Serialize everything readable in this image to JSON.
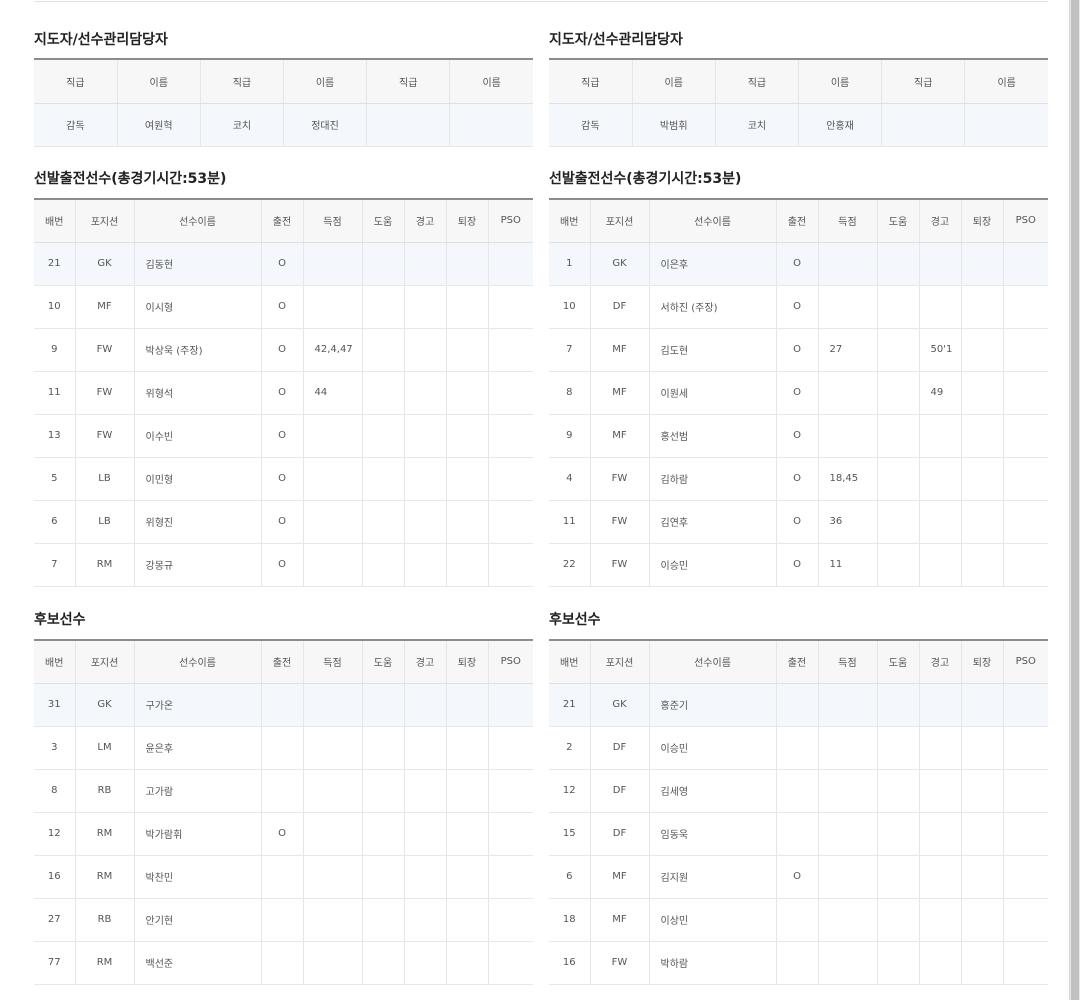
{
  "headers": {
    "staff": [
      "직급",
      "이름",
      "직급",
      "이름",
      "직급",
      "이름"
    ],
    "players": [
      "배번",
      "포지션",
      "선수이름",
      "출전",
      "득점",
      "도움",
      "경고",
      "퇴장",
      "PSO"
    ]
  },
  "home": {
    "staff_title": "지도자/선수관리담당자",
    "staff": [
      "감독",
      "여원혁",
      "코치",
      "정대진",
      "",
      ""
    ],
    "starters_title": "선발출전선수(총경기시간:53분)",
    "starters": [
      [
        "21",
        "GK",
        "김동현",
        "O",
        "",
        "",
        "",
        "",
        ""
      ],
      [
        "10",
        "MF",
        "이시형",
        "O",
        "",
        "",
        "",
        "",
        ""
      ],
      [
        "9",
        "FW",
        "박상욱 (주장)",
        "O",
        "42,4,47",
        "",
        "",
        "",
        ""
      ],
      [
        "11",
        "FW",
        "위형석",
        "O",
        "44",
        "",
        "",
        "",
        ""
      ],
      [
        "13",
        "FW",
        "이수빈",
        "O",
        "",
        "",
        "",
        "",
        ""
      ],
      [
        "5",
        "LB",
        "이민형",
        "O",
        "",
        "",
        "",
        "",
        ""
      ],
      [
        "6",
        "LB",
        "위형진",
        "O",
        "",
        "",
        "",
        "",
        ""
      ],
      [
        "7",
        "RM",
        "강몽규",
        "O",
        "",
        "",
        "",
        "",
        ""
      ]
    ],
    "subs_title": "후보선수",
    "subs": [
      [
        "31",
        "GK",
        "구가온",
        "",
        "",
        "",
        "",
        "",
        ""
      ],
      [
        "3",
        "LM",
        "윤은후",
        "",
        "",
        "",
        "",
        "",
        ""
      ],
      [
        "8",
        "RB",
        "고가람",
        "",
        "",
        "",
        "",
        "",
        ""
      ],
      [
        "12",
        "RM",
        "박가람휘",
        "O",
        "",
        "",
        "",
        "",
        ""
      ],
      [
        "16",
        "RM",
        "박찬민",
        "",
        "",
        "",
        "",
        "",
        ""
      ],
      [
        "27",
        "RB",
        "안기현",
        "",
        "",
        "",
        "",
        "",
        ""
      ],
      [
        "77",
        "RM",
        "백선준",
        "",
        "",
        "",
        "",
        "",
        ""
      ]
    ]
  },
  "away": {
    "staff_title": "지도자/선수관리담당자",
    "staff": [
      "감독",
      "박범휘",
      "코치",
      "안홍재",
      "",
      ""
    ],
    "starters_title": "선발출전선수(총경기시간:53분)",
    "starters": [
      [
        "1",
        "GK",
        "이은후",
        "O",
        "",
        "",
        "",
        "",
        ""
      ],
      [
        "10",
        "DF",
        "서하진 (주장)",
        "O",
        "",
        "",
        "",
        "",
        ""
      ],
      [
        "7",
        "MF",
        "김도현",
        "O",
        "27",
        "",
        "50'1",
        "",
        ""
      ],
      [
        "8",
        "MF",
        "이원세",
        "O",
        "",
        "",
        "49",
        "",
        ""
      ],
      [
        "9",
        "MF",
        "홍선범",
        "O",
        "",
        "",
        "",
        "",
        ""
      ],
      [
        "4",
        "FW",
        "김하람",
        "O",
        "18,45",
        "",
        "",
        "",
        ""
      ],
      [
        "11",
        "FW",
        "김연후",
        "O",
        "36",
        "",
        "",
        "",
        ""
      ],
      [
        "22",
        "FW",
        "이승민",
        "O",
        "11",
        "",
        "",
        "",
        ""
      ]
    ],
    "subs_title": "후보선수",
    "subs": [
      [
        "21",
        "GK",
        "홍준기",
        "",
        "",
        "",
        "",
        "",
        ""
      ],
      [
        "2",
        "DF",
        "이승민",
        "",
        "",
        "",
        "",
        "",
        ""
      ],
      [
        "12",
        "DF",
        "김세영",
        "",
        "",
        "",
        "",
        "",
        ""
      ],
      [
        "15",
        "DF",
        "임동욱",
        "",
        "",
        "",
        "",
        "",
        ""
      ],
      [
        "6",
        "MF",
        "김지원",
        "O",
        "",
        "",
        "",
        "",
        ""
      ],
      [
        "18",
        "MF",
        "이상민",
        "",
        "",
        "",
        "",
        "",
        ""
      ],
      [
        "16",
        "FW",
        "박하람",
        "",
        "",
        "",
        "",
        "",
        ""
      ]
    ]
  }
}
